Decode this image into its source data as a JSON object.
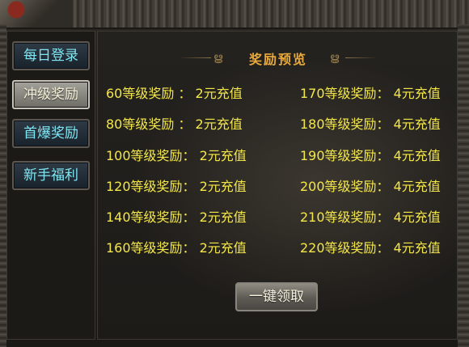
{
  "sidebar": {
    "items": [
      {
        "label": "每日登录",
        "active": false
      },
      {
        "label": "冲级奖励",
        "active": true
      },
      {
        "label": "首爆奖励",
        "active": false
      },
      {
        "label": "新手福利",
        "active": false
      }
    ]
  },
  "panel": {
    "title": "奖励预览",
    "rewards_left": [
      "60等级奖励 ： 2元充值",
      "80等级奖励 ： 2元充值",
      "100等级奖励： 2元充值",
      "120等级奖励： 2元充值",
      "140等级奖励： 2元充值",
      "160等级奖励： 2元充值"
    ],
    "rewards_right": [
      "170等级奖励： 4元充值",
      "180等级奖励： 4元充值",
      "190等级奖励： 4元充值",
      "200等级奖励： 4元充值",
      "210等级奖励： 4元充值",
      "220等级奖励： 4元充值"
    ],
    "claim_button": "一键领取"
  },
  "colors": {
    "reward_text": "#f4e74a",
    "title_text": "#e9a93c",
    "tab_text": "#7fe6f2"
  }
}
